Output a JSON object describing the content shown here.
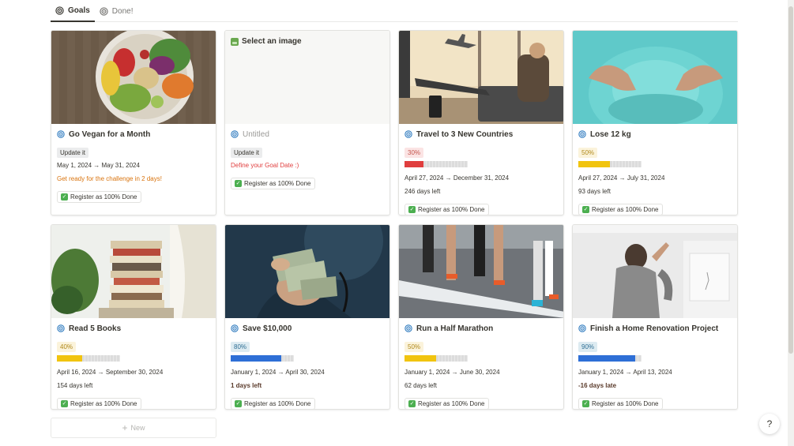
{
  "tabs": [
    {
      "label": "Goals",
      "icon": "target-icon",
      "active": true
    },
    {
      "label": "Done!",
      "icon": "target-icon",
      "active": false
    }
  ],
  "cards": [
    {
      "title": "Go Vegan for a Month",
      "cover": "vegan-bowl",
      "update_label": "Update it",
      "dates": "May 1, 2024 → May 31, 2024",
      "note": "Get ready for the challenge in 2 days!",
      "register_label": "Register as 100% Done"
    },
    {
      "title": "Untitled",
      "cover_text": "Select an image",
      "update_label": "Update it",
      "note": "Define your Goal Date :)",
      "register_label": "Register as 100% Done"
    },
    {
      "title": "Travel to 3 New Countries",
      "cover": "airport-travel",
      "percent_label": "30%",
      "progress": 0.3,
      "bar_color": "#e03e3e",
      "dates": "April 27, 2024 → December 31, 2024",
      "days": "246 days left",
      "register_label": "Register as 100% Done"
    },
    {
      "title": "Lose 12 kg",
      "cover": "weight-loss",
      "percent_label": "50%",
      "progress": 0.5,
      "bar_color": "#f1c40f",
      "dates": "April 27, 2024 → July 31, 2024",
      "days": "93 days left",
      "register_label": "Register as 100% Done"
    },
    {
      "title": "Read 5 Books",
      "cover": "book-stack",
      "percent_label": "40%",
      "progress": 0.4,
      "bar_color": "#f1c40f",
      "dates": "April 16, 2024 → September 30, 2024",
      "days": "154 days left",
      "register_label": "Register as 100% Done"
    },
    {
      "title": "Save $10,000",
      "cover": "money",
      "percent_label": "80%",
      "progress": 0.8,
      "bar_color": "#2e6fd6",
      "dates": "January 1, 2024 → April 30, 2024",
      "days": "1 days left",
      "register_label": "Register as 100% Done"
    },
    {
      "title": "Run a Half Marathon",
      "cover": "runners",
      "percent_label": "50%",
      "progress": 0.5,
      "bar_color": "#f1c40f",
      "dates": "January 1, 2024 → June 30, 2024",
      "days": "62 days left",
      "register_label": "Register as 100% Done"
    },
    {
      "title": "Finish a Home Renovation Project",
      "cover": "renovation",
      "percent_label": "90%",
      "progress": 0.9,
      "bar_color": "#2e6fd6",
      "dates": "January 1, 2024 → April 13, 2024",
      "days": "-16 days late",
      "register_label": "Register as 100% Done"
    }
  ],
  "new_button": {
    "label": "New"
  },
  "help_button": {
    "label": "?"
  }
}
